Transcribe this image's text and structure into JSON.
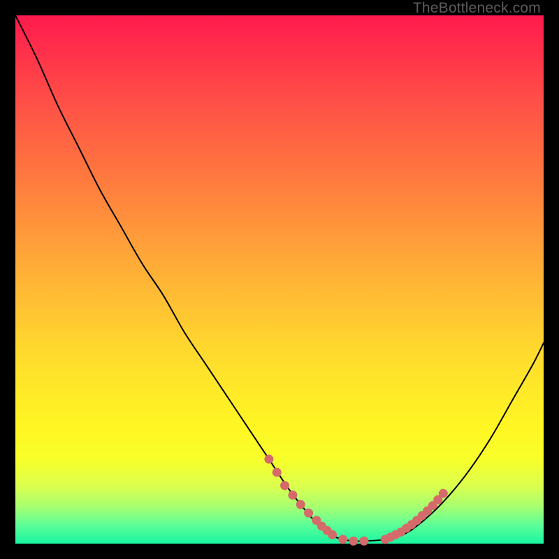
{
  "watermark": "TheBottleneck.com",
  "colors": {
    "frame": "#000000",
    "curve": "#000000",
    "marker": "#d46a6a",
    "gradient_top": "#ff1a4d",
    "gradient_bottom": "#18f5a0"
  },
  "chart_data": {
    "type": "line",
    "title": "",
    "xlabel": "",
    "ylabel": "",
    "xlim": [
      0,
      100
    ],
    "ylim": [
      0,
      100
    ],
    "grid": false,
    "legend": false,
    "annotations": [],
    "series": [
      {
        "name": "bottleneck-curve",
        "x": [
          0,
          4,
          8,
          12,
          16,
          20,
          24,
          28,
          32,
          36,
          40,
          44,
          48,
          52,
          56,
          58,
          60,
          62,
          64,
          66,
          70,
          74,
          78,
          82,
          86,
          90,
          94,
          98,
          100
        ],
        "y": [
          100,
          92,
          83,
          75,
          67,
          60,
          53,
          47,
          40,
          34,
          28,
          22,
          16,
          10,
          5,
          3,
          1.5,
          0.8,
          0.5,
          0.5,
          0.8,
          2,
          5,
          9,
          14,
          20,
          27,
          34,
          38
        ]
      }
    ],
    "markers": [
      {
        "name": "left-cluster",
        "x": [
          48,
          49.5,
          51,
          52.5,
          54,
          55.5,
          57,
          58,
          59,
          60,
          62,
          64,
          66
        ],
        "y": [
          16,
          13.5,
          11,
          9.2,
          7.4,
          5.8,
          4.4,
          3.3,
          2.5,
          1.7,
          0.8,
          0.5,
          0.5
        ]
      },
      {
        "name": "right-cluster",
        "x": [
          70,
          71,
          72,
          73,
          74,
          75,
          76,
          77,
          78,
          79,
          80,
          81
        ],
        "y": [
          0.8,
          1.2,
          1.7,
          2.2,
          2.9,
          3.6,
          4.4,
          5.3,
          6.2,
          7.2,
          8.3,
          9.5
        ]
      }
    ]
  }
}
